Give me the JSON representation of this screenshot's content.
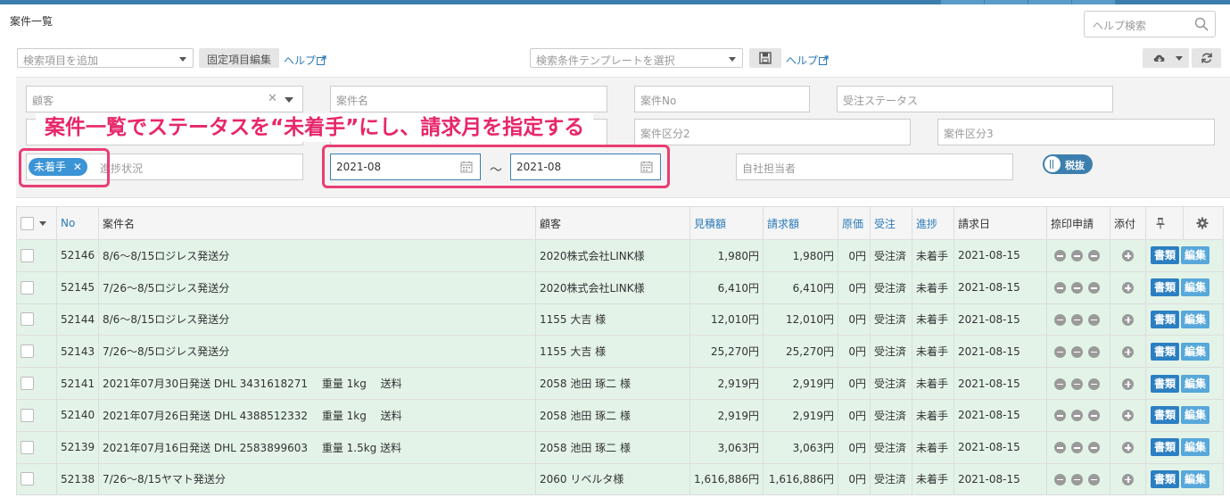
{
  "page": {
    "title": "案件一覧"
  },
  "help_search": {
    "placeholder": "ヘルプ検索"
  },
  "toolbar": {
    "add_search_item": "検索項目を追加",
    "fixed_items_edit": "固定項目編集",
    "help_left": "ヘルプ",
    "template_select": "検索条件テンプレートを選択",
    "help_right": "ヘルプ"
  },
  "filters": {
    "customer": "顧客",
    "project_name": "案件名",
    "project_no": "案件No",
    "order_status": "受注ステータス",
    "category2": "案件区分2",
    "category3": "案件区分3",
    "progress_tag": "未着手",
    "progress_placeholder": "進捗状況",
    "date_from": "2021-08",
    "date_sep": "～",
    "date_to": "2021-08",
    "staff": "自社担当者",
    "tax_toggle": "税抜"
  },
  "annotation": "案件一覧でステータスを“未着手”にし、請求月を指定する",
  "table": {
    "headers": {
      "no": "No",
      "name": "案件名",
      "customer": "顧客",
      "estimate": "見積額",
      "invoice": "請求額",
      "cost": "原価",
      "order": "受注",
      "progress": "進捗",
      "invoice_date": "請求日",
      "stamp": "捺印申請",
      "attach": "添付"
    },
    "doc_label": "書類",
    "edit_label": "編集",
    "rows": [
      {
        "no": "52146",
        "name": "8/6～8/15ロジレス発送分",
        "customer": "2020株式会社LINK様",
        "estimate": "1,980円",
        "invoice": "1,980円",
        "cost": "0円",
        "order": "受注済",
        "progress": "未着手",
        "date": "2021-08-15"
      },
      {
        "no": "52145",
        "name": "7/26～8/5ロジレス発送分",
        "customer": "2020株式会社LINK様",
        "estimate": "6,410円",
        "invoice": "6,410円",
        "cost": "0円",
        "order": "受注済",
        "progress": "未着手",
        "date": "2021-08-15"
      },
      {
        "no": "52144",
        "name": "8/6～8/15ロジレス発送分",
        "customer": "1155 大吉 様",
        "estimate": "12,010円",
        "invoice": "12,010円",
        "cost": "0円",
        "order": "受注済",
        "progress": "未着手",
        "date": "2021-08-15"
      },
      {
        "no": "52143",
        "name": "7/26～8/5ロジレス発送分",
        "customer": "1155 大吉 様",
        "estimate": "25,270円",
        "invoice": "25,270円",
        "cost": "0円",
        "order": "受注済",
        "progress": "未着手",
        "date": "2021-08-15"
      },
      {
        "no": "52141",
        "name": "2021年07月30日発送 DHL 3431618271　 重量 1kg　 送料",
        "customer": "2058 池田 琢二 様",
        "estimate": "2,919円",
        "invoice": "2,919円",
        "cost": "0円",
        "order": "受注済",
        "progress": "未着手",
        "date": "2021-08-15"
      },
      {
        "no": "52140",
        "name": "2021年07月26日発送 DHL 4388512332　 重量 1kg　 送料",
        "customer": "2058 池田 琢二 様",
        "estimate": "2,919円",
        "invoice": "2,919円",
        "cost": "0円",
        "order": "受注済",
        "progress": "未着手",
        "date": "2021-08-15"
      },
      {
        "no": "52139",
        "name": "2021年07月16日発送 DHL 2583899603　 重量 1.5kg 送料",
        "customer": "2058 池田 琢二 様",
        "estimate": "3,063円",
        "invoice": "3,063円",
        "cost": "0円",
        "order": "受注済",
        "progress": "未着手",
        "date": "2021-08-15"
      },
      {
        "no": "52138",
        "name": "7/26～8/15ヤマト発送分",
        "customer": "2060 リベルタ様",
        "estimate": "1,616,886円",
        "invoice": "1,616,886円",
        "cost": "0円",
        "order": "受注済",
        "progress": "未着手",
        "date": "2021-08-15"
      }
    ]
  },
  "colors": {
    "accent": "#3c7fae",
    "row_bg": "#e3f3e8",
    "annotation": "#e8266a",
    "tag": "#3b94d5"
  }
}
